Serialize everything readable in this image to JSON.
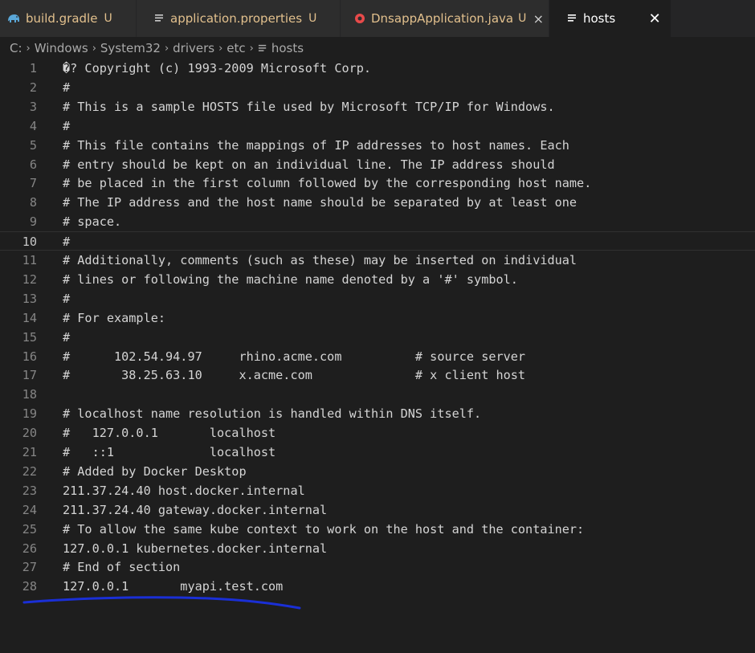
{
  "tabs": [
    {
      "label": "build.gradle",
      "status": "U",
      "icon": "gradle-elephant-icon",
      "modified": true,
      "active": false
    },
    {
      "label": "application.properties",
      "status": "U",
      "icon": "file-lines-icon",
      "modified": true,
      "active": false
    },
    {
      "label": "DnsappApplication.java",
      "status": "U",
      "icon": "java-icon",
      "modified": true,
      "active": false,
      "close": "×"
    },
    {
      "label": "hosts",
      "status": "",
      "icon": "file-lines-icon",
      "modified": false,
      "active": true,
      "close": "✕"
    }
  ],
  "breadcrumb": {
    "items": [
      "C:",
      "Windows",
      "System32",
      "drivers",
      "etc",
      "hosts"
    ],
    "separator": "›"
  },
  "editor": {
    "current_line": 10,
    "lines": [
      "�? Copyright (c) 1993-2009 Microsoft Corp.",
      "#",
      "# This is a sample HOSTS file used by Microsoft TCP/IP for Windows.",
      "#",
      "# This file contains the mappings of IP addresses to host names. Each",
      "# entry should be kept on an individual line. The IP address should",
      "# be placed in the first column followed by the corresponding host name.",
      "# The IP address and the host name should be separated by at least one",
      "# space.",
      "#",
      "# Additionally, comments (such as these) may be inserted on individual",
      "# lines or following the machine name denoted by a '#' symbol.",
      "#",
      "# For example:",
      "#",
      "#      102.54.94.97     rhino.acme.com          # source server",
      "#       38.25.63.10     x.acme.com              # x client host",
      "",
      "# localhost name resolution is handled within DNS itself.",
      "#   127.0.0.1       localhost",
      "#   ::1             localhost",
      "# Added by Docker Desktop",
      "211.37.24.40 host.docker.internal",
      "211.37.24.40 gateway.docker.internal",
      "# To allow the same kube context to work on the host and the container:",
      "127.0.0.1 kubernetes.docker.internal",
      "# End of section",
      "127.0.0.1       myapi.test.com"
    ]
  },
  "colors": {
    "modified": "#e2c08d",
    "annotation_underline": "#1a2fd6",
    "java_icon": "#e84a4a",
    "gradle_icon": "#5aa7d8"
  }
}
